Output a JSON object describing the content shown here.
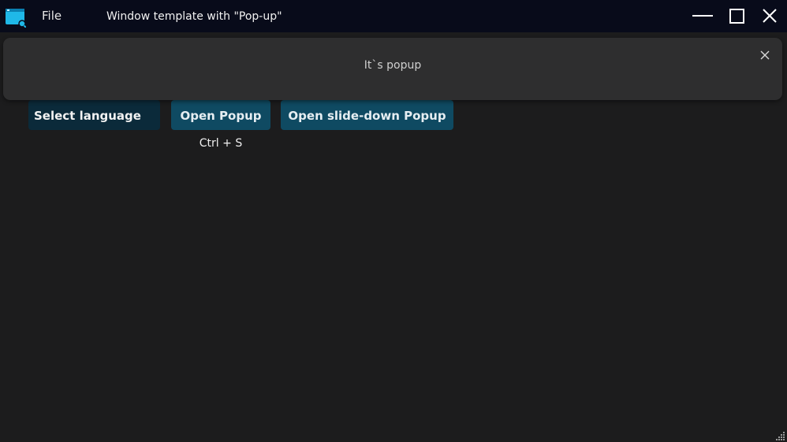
{
  "titlebar": {
    "menu": {
      "file_label": "File"
    },
    "title": "Window template with \"Pop-up\"",
    "icons": {
      "app": "app-window-icon",
      "minimize": "minimize-icon",
      "maximize": "maximize-icon",
      "close": "close-icon"
    }
  },
  "popup": {
    "message": "It`s popup",
    "close_icon": "close-icon"
  },
  "controls": {
    "language_select": {
      "value": "Select language"
    },
    "open_popup_label": "Open Popup",
    "open_slide_down_label": "Open slide-down Popup",
    "shortcut_hint": "Ctrl + S"
  },
  "colors": {
    "titlebar_bg": "#080b1a",
    "window_bg": "#1c1c1d",
    "popup_bg": "#2e2e2f",
    "button_bg": "#0f4a62",
    "select_bg": "#0b2a3a",
    "app_icon_accent": "#1fb8e8"
  }
}
